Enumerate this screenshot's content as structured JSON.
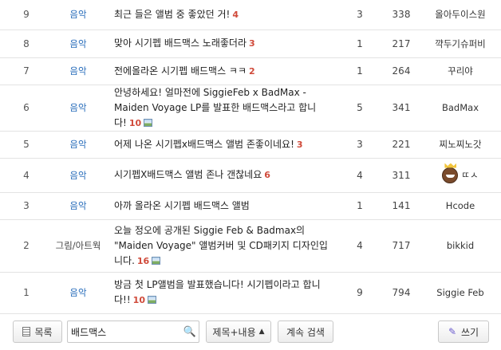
{
  "rows": [
    {
      "no": "9",
      "category": "음악",
      "title": "최근 들은 앨범 중 좋았던 거!",
      "comments": "4",
      "has_image": false,
      "votes": "3",
      "views": "338",
      "author": "올아두이스원"
    },
    {
      "no": "8",
      "category": "음악",
      "title": "맞아 시기펩 배드맥스 노래좋더라",
      "comments": "3",
      "has_image": false,
      "votes": "1",
      "views": "217",
      "author": "꺅두기슈퍼비"
    },
    {
      "no": "7",
      "category": "음악",
      "title": "전에올라온 시기펩 배드맥스 ㅋㅋ",
      "comments": "2",
      "has_image": false,
      "votes": "1",
      "views": "264",
      "author": "꾸리야"
    },
    {
      "no": "6",
      "category": "음악",
      "title": "안녕하세요! 얼마전에 SiggieFeb x BadMax - Maiden Voyage LP를 발표한 배드맥스라고 합니다!",
      "comments": "10",
      "has_image": true,
      "votes": "5",
      "views": "341",
      "author": "BadMax"
    },
    {
      "no": "5",
      "category": "음악",
      "title": "어제 나온 시기펩x배드맥스 앨범 존좋이네요!",
      "comments": "3",
      "has_image": false,
      "votes": "3",
      "views": "221",
      "author": "찌노찌노갓"
    },
    {
      "no": "4",
      "category": "음악",
      "title": "시기펩X배드맥스 앨범 존나 갠찮네요",
      "comments": "6",
      "has_image": false,
      "votes": "4",
      "views": "311",
      "author": "ㄸㅅ"
    },
    {
      "no": "3",
      "category": "음악",
      "title": "아까 올라온 시기펩 배드맥스 앨범",
      "comments": "",
      "has_image": false,
      "votes": "1",
      "views": "141",
      "author": "Hcode"
    },
    {
      "no": "2",
      "category": "그림/아트웍",
      "title": "오늘 정오에 공개된 Siggie Feb & Badmax의 \"Maiden Voyage\" 앨범커버 및 CD패키지 디자인입니다.",
      "comments": "16",
      "has_image": true,
      "votes": "4",
      "views": "717",
      "author": "bikkid"
    },
    {
      "no": "1",
      "category": "음악",
      "title": "방금 첫 LP앨범을 발표했습니다! 시기펩이라고 합니다!!",
      "comments": "10",
      "has_image": true,
      "votes": "9",
      "views": "794",
      "author": "Siggie Feb"
    }
  ],
  "toolbar": {
    "list_label": "목록",
    "search_value": "배드맥스",
    "search_scope": "제목+내용",
    "continue_search_label": "계속 검색",
    "write_label": "쓰기"
  }
}
